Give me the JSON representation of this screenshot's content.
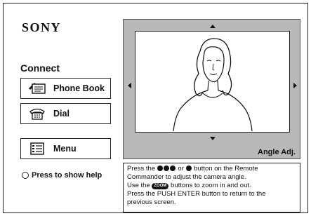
{
  "brand": "SONY",
  "connect_label": "Connect",
  "buttons": {
    "phone_book": "Phone Book",
    "dial": "Dial",
    "menu": "Menu"
  },
  "help_text": "Press to show help",
  "angle_label": "Angle Adj.",
  "info": {
    "line1_a": "Press the",
    "line1_b": "or",
    "line1_c": "button on the Remote",
    "line2": "Commander to adjust the camera angle.",
    "line3_a": "Use the",
    "zoom_badge": "ZOOM",
    "line3_b": "buttons to zoom in and out.",
    "line4": "Press the PUSH ENTER button to return to the",
    "line5": "previous screen."
  }
}
